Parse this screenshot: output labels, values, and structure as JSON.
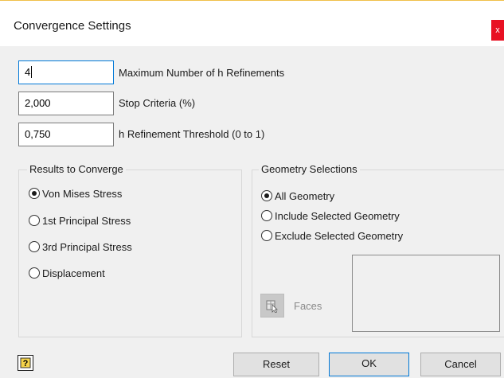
{
  "dialog": {
    "title": "Convergence Settings",
    "close_glyph": "x"
  },
  "fields": [
    {
      "value": "4",
      "label": "Maximum Number of h Refinements"
    },
    {
      "value": "2,000",
      "label": "Stop Criteria (%)"
    },
    {
      "value": "0,750",
      "label": "h Refinement Threshold (0 to 1)"
    }
  ],
  "results_group": {
    "title": "Results to Converge",
    "options": [
      {
        "label": "Von Mises Stress",
        "selected": true
      },
      {
        "label": "1st Principal Stress",
        "selected": false
      },
      {
        "label": "3rd Principal Stress",
        "selected": false
      },
      {
        "label": "Displacement",
        "selected": false
      }
    ]
  },
  "geometry_group": {
    "title": "Geometry Selections",
    "options": [
      {
        "label": "All Geometry",
        "selected": true
      },
      {
        "label": "Include Selected Geometry",
        "selected": false
      },
      {
        "label": "Exclude Selected Geometry",
        "selected": false
      }
    ],
    "faces_label": "Faces"
  },
  "footer": {
    "help_icon": "help-icon",
    "reset_label": "Reset",
    "ok_label": "OK",
    "cancel_label": "Cancel"
  },
  "colors": {
    "accent": "#0078d7",
    "close": "#e81123",
    "dialog_bg": "#f0f0f0"
  }
}
